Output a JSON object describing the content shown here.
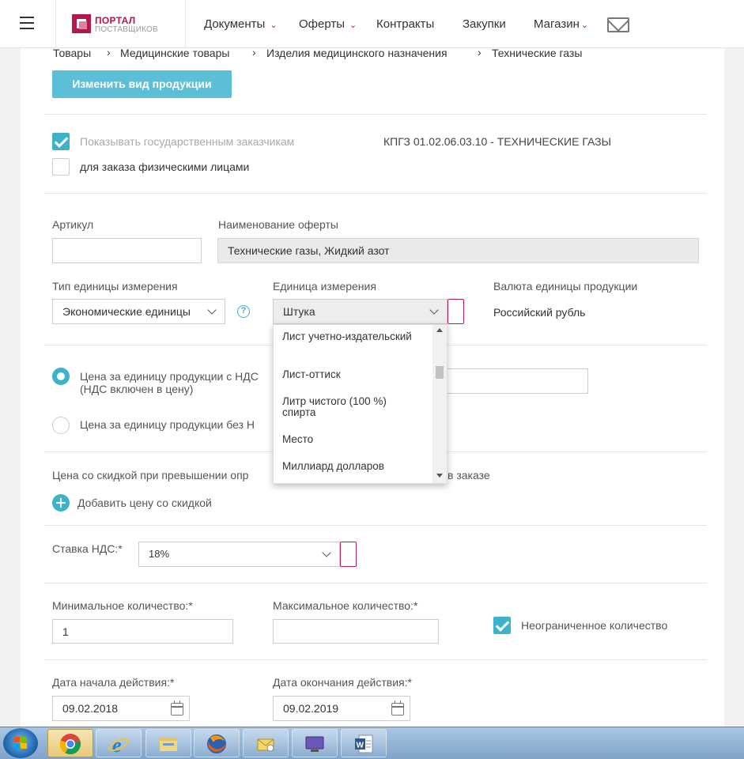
{
  "header": {
    "logo_line1": "ПОРТАЛ",
    "logo_line2": "ПОСТАВЩИКОВ",
    "nav": [
      {
        "label": "Документы",
        "has_dropdown": true
      },
      {
        "label": "Оферты",
        "has_dropdown": true
      },
      {
        "label": "Контракты",
        "has_dropdown": false
      },
      {
        "label": "Закупки",
        "has_dropdown": false
      },
      {
        "label": "Магазин",
        "has_dropdown": true
      }
    ],
    "chevron": "⌄"
  },
  "breadcrumb": {
    "items": [
      "Товары",
      "Медицинские товары",
      "Изделия медицинского назначения",
      "Технические газы"
    ],
    "separator": "›"
  },
  "change_button": "Изменить вид продукции",
  "visibility": {
    "show_to_gov_label": "Показывать государственным заказчикам",
    "show_to_gov_checked": true,
    "individuals_label": "для заказа физическими лицами",
    "individuals_checked": false,
    "kpgz": "КПГЗ  01.02.06.03.10 - ТЕХНИЧЕСКИЕ ГАЗЫ"
  },
  "article": {
    "label": "Артикул",
    "value": ""
  },
  "offer_name": {
    "label": "Наименование оферты",
    "value": "Технические газы,  Жидкий азот"
  },
  "unit_type": {
    "label": "Тип единицы измерения",
    "value": "Экономические единицы",
    "help": "?"
  },
  "unit": {
    "label": "Единица измерения",
    "value": "Штука",
    "options": [
      "Лист учетно-издательский",
      "Лист-оттиск",
      "Литр чистого (100 %) спирта",
      "Место",
      "Миллиард долларов"
    ]
  },
  "currency": {
    "label": "Валюта единицы продукции",
    "value": "Российский рубль"
  },
  "price": {
    "with_vat_label": "Цена за единицу продукции с НДС",
    "with_vat_note": "(НДС включен в цену)",
    "with_vat_selected": true,
    "without_vat_label": "Цена за единицу продукции без Н",
    "without_vat_selected": false,
    "value": ""
  },
  "discount": {
    "label_left": "Цена со скидкой при превышении опр",
    "label_right": "в заказе",
    "add_label": "Добавить цену со скидкой"
  },
  "vat": {
    "label": "Ставка НДС:",
    "required": "*",
    "value": "18%"
  },
  "min_qty": {
    "label": "Минимальное количество:",
    "required": "*",
    "value": "1"
  },
  "max_qty": {
    "label": "Максимальное количество:",
    "required": "*",
    "value": ""
  },
  "unlimited": {
    "label": "Неограниченное количество",
    "checked": true
  },
  "start_date": {
    "label": "Дата начала действия:",
    "required": "*",
    "value": "09.02.2018"
  },
  "end_date": {
    "label": "Дата окончания действия:",
    "required": "*",
    "value": "09.02.2019"
  },
  "taskbar": {
    "items": [
      "chrome-icon",
      "internet-explorer-icon",
      "file-explorer-icon",
      "firefox-icon",
      "outlook-icon",
      "remote-desktop-icon",
      "word-icon"
    ],
    "active": "chrome-icon"
  },
  "colors": {
    "accent": "#3cb3c8",
    "brand": "#b5174b",
    "button": "#5bc0d6",
    "required_border": "#c01c4b"
  }
}
